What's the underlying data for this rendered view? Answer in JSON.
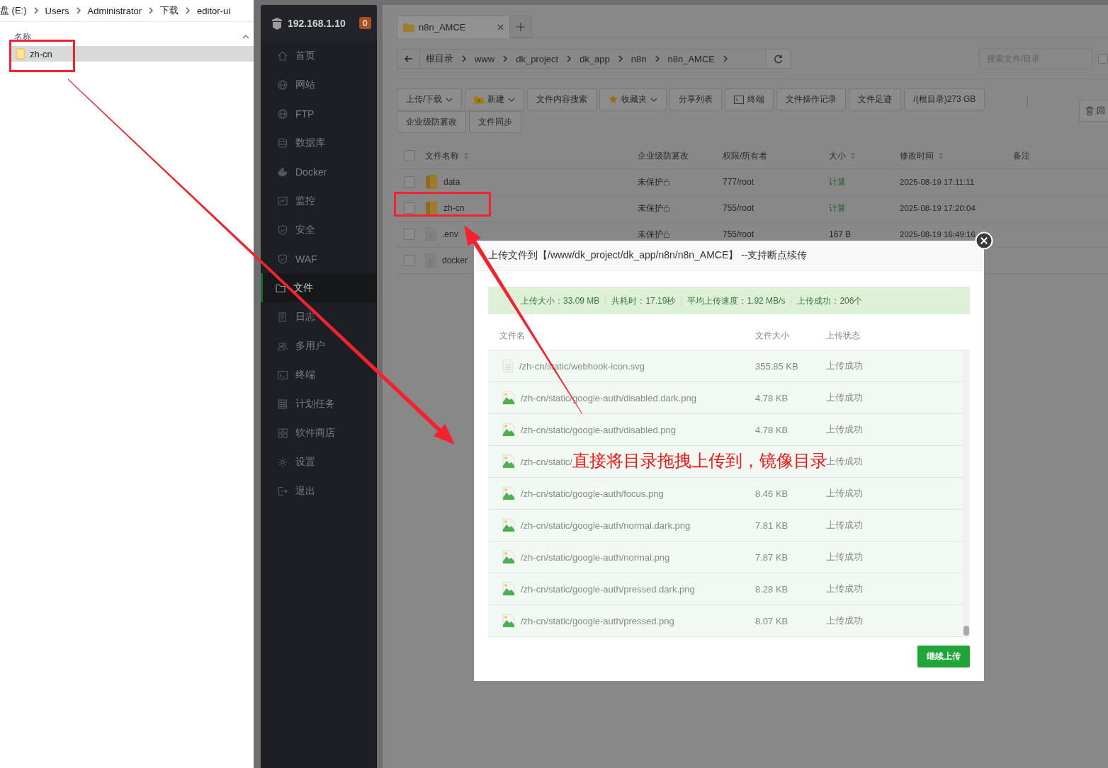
{
  "explorer": {
    "breadcrumb": [
      "盘 (E:)",
      "Users",
      "Administrator",
      "下载",
      "editor-ui"
    ],
    "column": "名称",
    "rows": [
      {
        "name": "zh-cn",
        "selected": true
      }
    ]
  },
  "panel": {
    "host": "192.168.1.10",
    "badge": "0",
    "menu": [
      {
        "label": "首页",
        "selected": false
      },
      {
        "label": "网站",
        "selected": false
      },
      {
        "label": "FTP",
        "selected": false
      },
      {
        "label": "数据库",
        "selected": false
      },
      {
        "label": "Docker",
        "selected": false
      },
      {
        "label": "监控",
        "selected": false
      },
      {
        "label": "安全",
        "selected": false
      },
      {
        "label": "WAF",
        "selected": false
      },
      {
        "label": "文件",
        "selected": true
      },
      {
        "label": "日志",
        "selected": false
      },
      {
        "label": "多用户",
        "selected": false
      },
      {
        "label": "终端",
        "selected": false
      },
      {
        "label": "计划任务",
        "selected": false
      },
      {
        "label": "软件商店",
        "selected": false
      },
      {
        "label": "设置",
        "selected": false
      },
      {
        "label": "退出",
        "selected": false
      }
    ]
  },
  "files": {
    "tabs": [
      {
        "label": "n8n_AMCE",
        "selected": true
      }
    ],
    "path": [
      "根目录",
      "www",
      "dk_project",
      "dk_app",
      "n8n",
      "n8n_AMCE"
    ],
    "search": {
      "placeholder": "搜索文件/目录",
      "checked": false
    },
    "toolbar": [
      {
        "label": "上传/下载",
        "dropdown": true
      },
      {
        "label": "新建",
        "dropdown": true
      },
      {
        "label": "文件内容搜索",
        "dropdown": false
      },
      {
        "label": "收藏夹",
        "dropdown": true
      },
      {
        "label": "分享列表",
        "dropdown": false
      },
      {
        "label": "终端",
        "dropdown": false
      },
      {
        "label": "文件操作记录",
        "dropdown": false
      },
      {
        "label": "文件足迹",
        "dropdown": false
      },
      {
        "label": "/(根目录)273 GB",
        "dropdown": false
      },
      {
        "label": "企业级防篡改",
        "dropdown": false
      },
      {
        "label": "文件同步",
        "dropdown": false
      }
    ],
    "trash_button": "回",
    "all_checked": false,
    "columns": [
      {
        "label": "文件名称",
        "sortable": true
      },
      {
        "label": "企业级防篡改",
        "sortable": false
      },
      {
        "label": "权限/所有者",
        "sortable": false
      },
      {
        "label": "大小",
        "sortable": true
      },
      {
        "label": "修改时间",
        "sortable": true
      },
      {
        "label": "备注",
        "sortable": false
      }
    ],
    "rows": [
      {
        "kind": "folder",
        "checked": false,
        "name": "data",
        "protect": "未保护",
        "perm": "777/root",
        "size": "计算",
        "time": "2025-08-19 17:11:11"
      },
      {
        "kind": "folder",
        "checked": false,
        "name": "zh-cn",
        "protect": "未保护",
        "perm": "755/root",
        "size": "计算",
        "time": "2025-08-19 17:20:04"
      },
      {
        "kind": "file",
        "checked": false,
        "name": ".env",
        "protect": "未保护",
        "perm": "755/root",
        "size": "167 B",
        "time": "2025-08-19 16:49:16"
      },
      {
        "kind": "file",
        "checked": false,
        "name": "docker"
      }
    ]
  },
  "dialog": {
    "title": "上传文件到【/www/dk_project/dk_app/n8n/n8n_AMCE】 --支持断点续传",
    "summary": [
      "上传大小：33.09 MB",
      "共耗时：17.19秒",
      "平均上传速度：1.92 MB/s",
      "上传成功：206个"
    ],
    "columns": [
      "文件名",
      "文件大小",
      "上传状态"
    ],
    "rows": [
      {
        "kind": "svg",
        "name": "/zh-cn/static/webhook-icon.svg",
        "size": "355.85 KB",
        "status": "上传成功"
      },
      {
        "kind": "png",
        "name": "/zh-cn/static/google-auth/disabled.dark.png",
        "size": "4.78 KB",
        "status": "上传成功"
      },
      {
        "kind": "png",
        "name": "/zh-cn/static/google-auth/disabled.png",
        "size": "4.78 KB",
        "status": "上传成功"
      },
      {
        "kind": "png",
        "name": "/zh-cn/static/",
        "status": "上传成功"
      },
      {
        "kind": "png",
        "name": "/zh-cn/static/google-auth/focus.png",
        "size": "8.46 KB",
        "status": "上传成功"
      },
      {
        "kind": "png",
        "name": "/zh-cn/static/google-auth/normal.dark.png",
        "size": "7.81 KB",
        "status": "上传成功"
      },
      {
        "kind": "png",
        "name": "/zh-cn/static/google-auth/normal.png",
        "size": "7.87 KB",
        "status": "上传成功"
      },
      {
        "kind": "png",
        "name": "/zh-cn/static/google-auth/pressed.dark.png",
        "size": "8.28 KB",
        "status": "上传成功"
      },
      {
        "kind": "png",
        "name": "/zh-cn/static/google-auth/pressed.png",
        "size": "8.07 KB",
        "status": "上传成功"
      }
    ],
    "button": "继续上传"
  },
  "annotation": {
    "text": "直接将目录拖拽上传到，镜像目录"
  }
}
